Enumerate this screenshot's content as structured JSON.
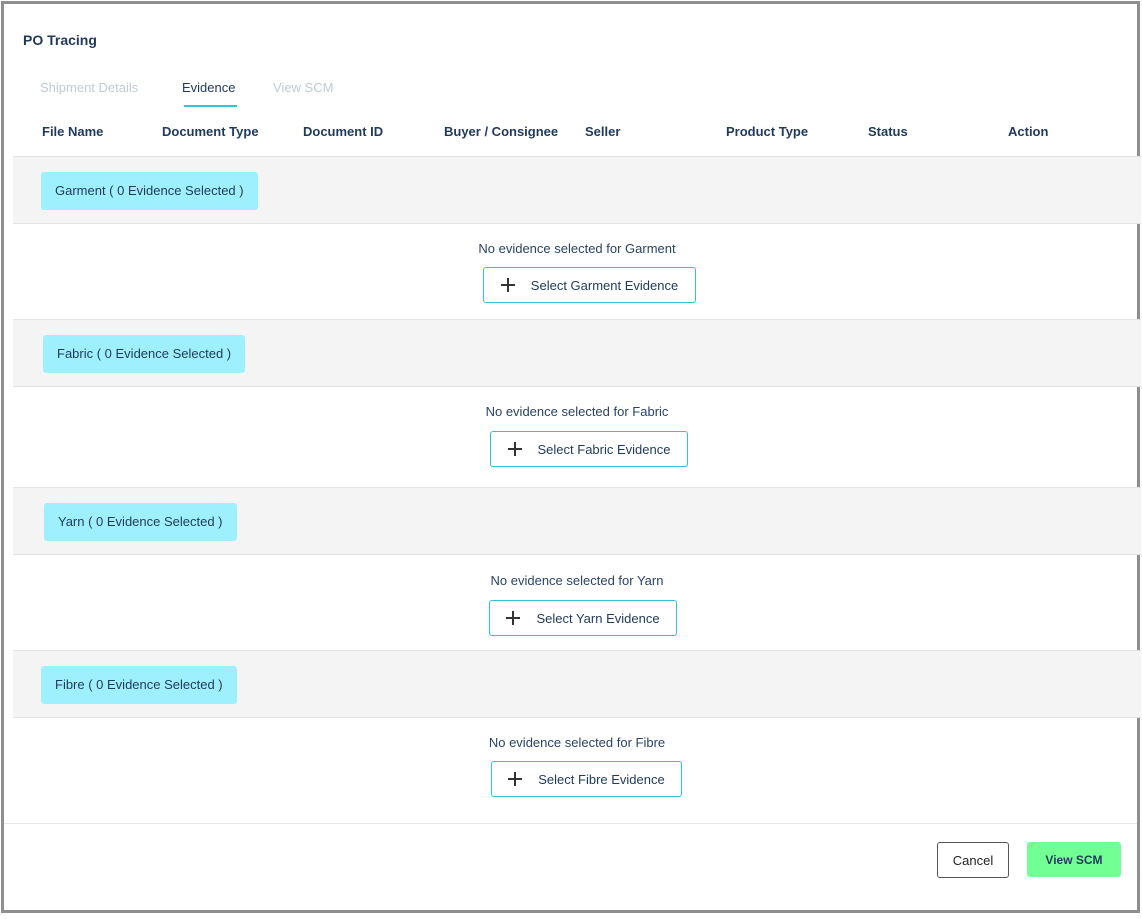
{
  "modal": {
    "title": "PO Tracing"
  },
  "tabs": [
    {
      "label": "Shipment Details"
    },
    {
      "label": "Evidence"
    },
    {
      "label": "View SCM"
    }
  ],
  "columns": [
    "File Name",
    "Document Type",
    "Document ID",
    "Buyer / Consignee",
    "Seller",
    "Product Type",
    "Status",
    "Action"
  ],
  "sections": [
    {
      "chip": "Garment ( 0 Evidence Selected )",
      "message": "No evidence selected for Garment",
      "button": "Select Garment Evidence"
    },
    {
      "chip": "Fabric ( 0 Evidence Selected )",
      "message": "No evidence selected for Fabric",
      "button": "Select Fabric Evidence"
    },
    {
      "chip": "Yarn ( 0 Evidence Selected )",
      "message": "No evidence selected for Yarn",
      "button": "Select Yarn Evidence"
    },
    {
      "chip": "Fibre ( 0 Evidence Selected )",
      "message": "No evidence selected for Fibre",
      "button": "Select Fibre Evidence"
    }
  ],
  "footer": {
    "cancel_label": "Cancel",
    "view_scm_label": "View SCM"
  },
  "colors": {
    "accent": "#36c2d9",
    "chip": "#9ff0ff",
    "primary_button": "#72ff93",
    "text": "#1f3a5c"
  },
  "icons": {
    "select_button": "plus-icon"
  }
}
